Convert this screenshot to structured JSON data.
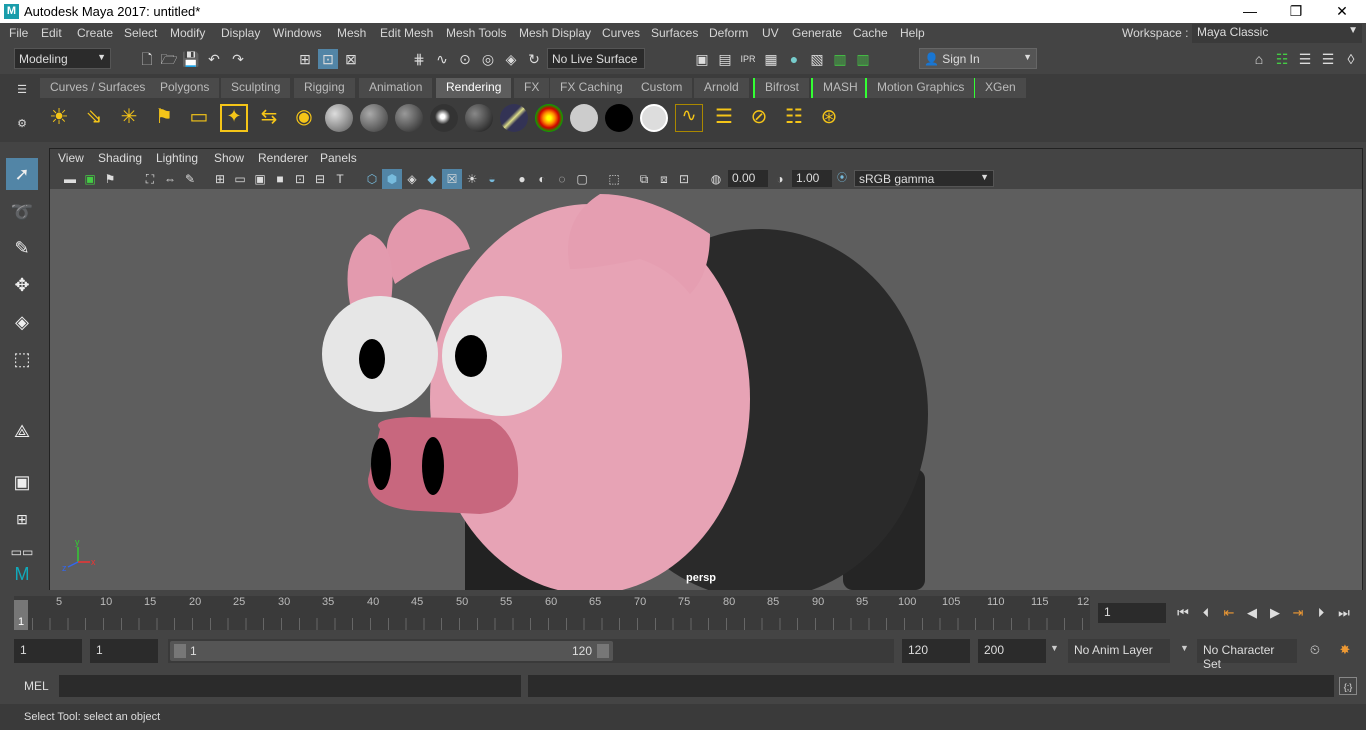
{
  "window": {
    "title": "Autodesk Maya 2017: untitled*",
    "minimize": "—",
    "restore": "❐",
    "close": "✕"
  },
  "menu": [
    "File",
    "Edit",
    "Create",
    "Select",
    "Modify",
    "Display",
    "Windows",
    "Mesh",
    "Edit Mesh",
    "Mesh Tools",
    "Mesh Display",
    "Curves",
    "Surfaces",
    "Deform",
    "UV",
    "Generate",
    "Cache",
    "Help"
  ],
  "workspace": {
    "label": "Workspace :",
    "value": "Maya Classic"
  },
  "statusline": {
    "mode": "Modeling",
    "live_surface": "No Live Surface",
    "sign_in": "Sign In"
  },
  "shelf_tabs": [
    "Curves / Surfaces",
    "Polygons",
    "Sculpting",
    "Rigging",
    "Animation",
    "Rendering",
    "FX",
    "FX Caching",
    "Custom",
    "Arnold",
    "Bifrost",
    "MASH",
    "Motion Graphics",
    "XGen"
  ],
  "active_shelf_tab": "Rendering",
  "viewport": {
    "menus": [
      "View",
      "Shading",
      "Lighting",
      "Show",
      "Renderer",
      "Panels"
    ],
    "exposure": "0.00",
    "gamma": "1.00",
    "color_space": "sRGB gamma",
    "camera_label": "persp",
    "axis": {
      "x": "x",
      "y": "y",
      "z": "z"
    }
  },
  "timeline": {
    "ticks": [
      "1",
      "5",
      "10",
      "15",
      "20",
      "25",
      "30",
      "35",
      "40",
      "45",
      "50",
      "55",
      "60",
      "65",
      "70",
      "75",
      "80",
      "85",
      "90",
      "95",
      "100",
      "105",
      "110",
      "115",
      "12"
    ],
    "current_frame": "1"
  },
  "range": {
    "start": "1",
    "inner_start": "1",
    "slider_start": "1",
    "slider_end": "120",
    "end": "120",
    "outer_end": "200",
    "anim_layer": "No Anim Layer",
    "character_set": "No Character Set"
  },
  "command": {
    "lang": "MEL"
  },
  "help_line": "Select Tool: select an object",
  "colors": {
    "pig_pink": "#e7a3b5",
    "snout": "#c8677e",
    "body_black": "#2a2a2a",
    "viewport_bg": "#5e5e5e",
    "highlight": "#5285a6"
  }
}
